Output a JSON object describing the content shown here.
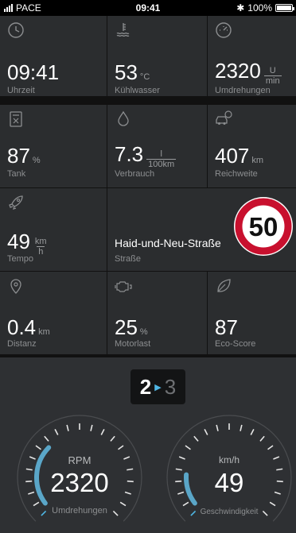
{
  "status_bar": {
    "carrier": "PACE",
    "time": "09:41",
    "battery_text": "100%"
  },
  "tiles": {
    "clock": {
      "icon": "clock-icon",
      "value": "09:41",
      "label": "Uhrzeit"
    },
    "coolant": {
      "icon": "coolant-temperature-icon",
      "value": "53",
      "unit": "°C",
      "label": "Kühlwasser"
    },
    "rpm": {
      "icon": "tachometer-icon",
      "value": "2320",
      "unit_num": "U",
      "unit_den": "min",
      "label": "Umdrehungen"
    },
    "tank": {
      "icon": "fuel-tank-icon",
      "value": "87",
      "unit": "%",
      "label": "Tank"
    },
    "consumption": {
      "icon": "fuel-drop-icon",
      "value": "7.3",
      "unit_num": "l",
      "unit_den": "100km",
      "label": "Verbrauch"
    },
    "range": {
      "icon": "car-range-icon",
      "value": "407",
      "unit": "km",
      "label": "Reichweite"
    },
    "speed": {
      "icon": "rocket-icon",
      "value": "49",
      "unit_num": "km",
      "unit_den": "h",
      "label": "Tempo"
    },
    "street": {
      "value": "Haid-und-Neu-Straße",
      "label": "Straße",
      "speed_limit": "50"
    },
    "distance": {
      "icon": "location-pin-icon",
      "value": "0.4",
      "unit": "km",
      "label": "Distanz"
    },
    "load": {
      "icon": "engine-icon",
      "value": "25",
      "unit": "%",
      "label": "Motorlast"
    },
    "eco": {
      "icon": "leaf-icon",
      "value": "87",
      "label": "Eco-Score"
    }
  },
  "gear": {
    "current": "2",
    "next": "3"
  },
  "gauges": {
    "rpm": {
      "title": "RPM",
      "value": "2320",
      "caption": "Umdrehungen",
      "level": 0.33
    },
    "speed": {
      "title": "km/h",
      "value": "49",
      "caption": "Geschwindigkeit",
      "level": 0.18
    }
  },
  "colors": {
    "accent": "#4fb7e6",
    "gauge_fill": "#5aa6c8",
    "tile_bg": "#2b2d2f",
    "speed_sign_red": "#c8102e"
  }
}
